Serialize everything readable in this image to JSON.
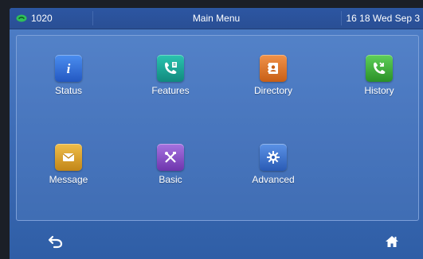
{
  "statusbar": {
    "line_label": "1020",
    "title": "Main Menu",
    "datetime": "16 18 Wed Sep 3"
  },
  "menu": {
    "items": [
      {
        "label": "Status",
        "icon": "info-icon",
        "color": "#2f6fd6"
      },
      {
        "label": "Features",
        "icon": "features-phone-icon",
        "color": "#1aa596"
      },
      {
        "label": "Directory",
        "icon": "contact-book-icon",
        "color": "#e07a2e"
      },
      {
        "label": "History",
        "icon": "call-history-icon",
        "color": "#3fae3a"
      },
      {
        "label": "Message",
        "icon": "envelope-icon",
        "color": "#d9a12a"
      },
      {
        "label": "Basic",
        "icon": "tools-icon",
        "color": "#8a52c6"
      },
      {
        "label": "Advanced",
        "icon": "gear-icon",
        "color": "#3a6fc6"
      }
    ]
  },
  "navigation": {
    "back_icon": "back-arrow-icon",
    "home_icon": "home-icon"
  },
  "colors": {
    "screen_top": "#4f7fc7",
    "screen_bottom": "#2f5ea6",
    "statusbar": "#2c56a2",
    "line_indicator": "#2fbf5a"
  }
}
